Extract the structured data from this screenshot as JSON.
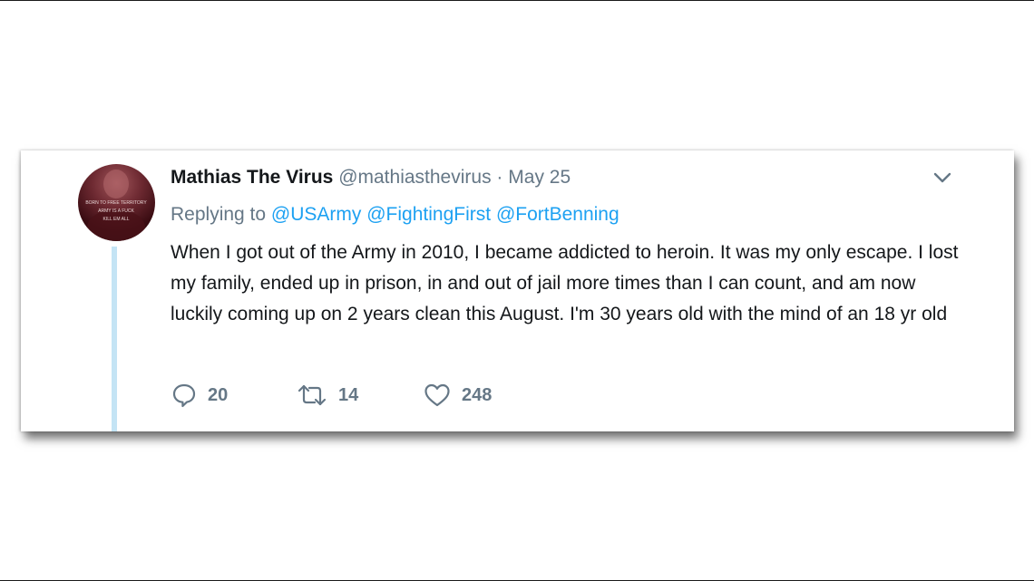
{
  "tweet": {
    "author_name": "Mathias The Virus",
    "author_handle": "@mathiasthevirus",
    "separator": "·",
    "date": "May 25",
    "replying_label": "Replying to",
    "mentions": [
      "@USArmy",
      "@FightingFirst",
      "@FortBenning"
    ],
    "text": "When I got out of the Army in 2010, I became addicted to heroin. It was my only escape. I lost my family, ended up in prison, in and out of jail more times than I can count, and am now luckily coming up on 2 years clean this August. I'm 30 years old with the mind of an 18 yr old",
    "avatar_text": [
      "BORN TO FREE TERRITORY",
      "ARMY IS A FUCK",
      "KILL EM ALL"
    ]
  },
  "actions": {
    "reply_count": "20",
    "retweet_count": "14",
    "like_count": "248"
  },
  "icons": {
    "reply": "speech-bubble-icon",
    "retweet": "retweet-arrows-icon",
    "like": "heart-icon",
    "menu": "chevron-down-icon"
  },
  "colors": {
    "link": "#1da1f2",
    "secondary_text": "#657786",
    "primary_text": "#14171a",
    "thread_line": "#c4e4f5"
  }
}
